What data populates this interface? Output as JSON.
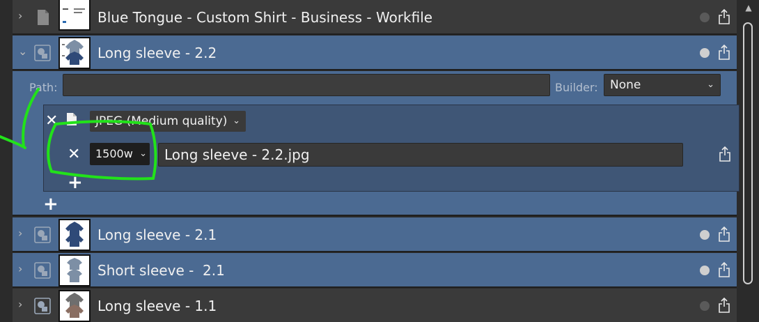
{
  "rows": [
    {
      "id": "workfile",
      "label": "Blue Tongue - Custom Shirt - Business - Workfile",
      "expanded": false,
      "icon": "document-icon",
      "dot": "dim"
    },
    {
      "id": "ls22",
      "label": "Long sleeve - 2.2",
      "expanded": true,
      "icon": "slice-icon",
      "dot": "light"
    },
    {
      "id": "ls21",
      "label": "Long sleeve - 2.1",
      "expanded": false,
      "icon": "slice-icon",
      "dot": "light"
    },
    {
      "id": "ss21",
      "label": "Short sleeve -  2.1",
      "expanded": false,
      "icon": "slice-icon",
      "dot": "light"
    },
    {
      "id": "ls11",
      "label": "Long sleeve - 1.1",
      "expanded": false,
      "icon": "slice-icon",
      "dot": "dim"
    }
  ],
  "expanded_panel": {
    "path_label": "Path:",
    "path_value": "",
    "builder_label": "Builder:",
    "builder_value": "None",
    "format": "JPEG (Medium quality)",
    "size": "1500w",
    "filename": "Long sleeve - 2.2.jpg"
  },
  "colors": {
    "row_dark": "#3a3a3a",
    "row_selected": "#4b6a92",
    "export_box": "#3f5676",
    "annotation_green": "#22e21a"
  }
}
